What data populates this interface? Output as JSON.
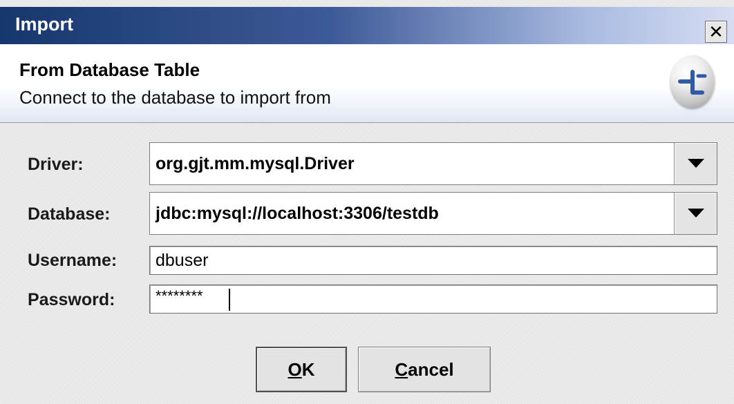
{
  "window": {
    "title": "Import",
    "close_glyph": "✕"
  },
  "header": {
    "title": "From Database Table",
    "subtitle": "Connect to the database to import from",
    "logo_icon": "wizard-logo-icon"
  },
  "form": {
    "driver": {
      "label": "Driver:",
      "value": "org.gjt.mm.mysql.Driver",
      "dropdown_icon": "chevron-down-icon"
    },
    "database": {
      "label": "Database:",
      "value": "jdbc:mysql://localhost:3306/testdb",
      "dropdown_icon": "chevron-down-icon"
    },
    "username": {
      "label": "Username:",
      "value": "dbuser"
    },
    "password": {
      "label": "Password:",
      "value": "********"
    }
  },
  "buttons": {
    "ok": {
      "mnemonic": "O",
      "rest": "K"
    },
    "cancel": {
      "mnemonic": "C",
      "rest": "ancel"
    }
  },
  "colors": {
    "titlebar_start": "#17366d",
    "titlebar_end": "#d6ddf2",
    "logo_accent": "#2f5aa8"
  }
}
